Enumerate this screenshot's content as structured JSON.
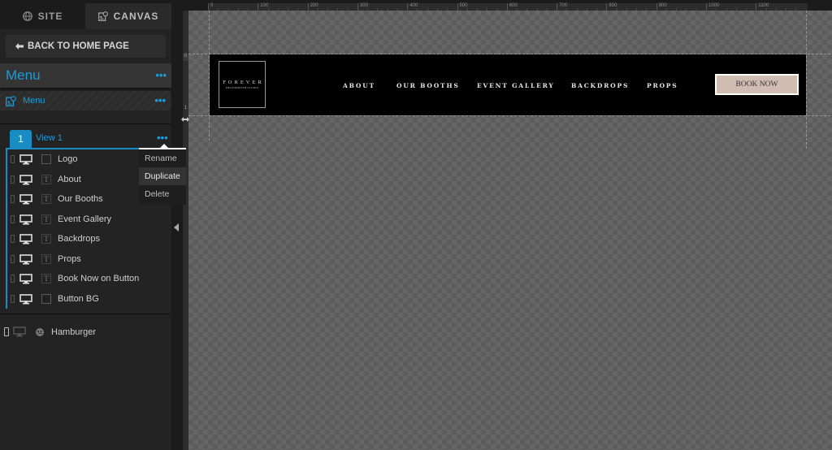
{
  "sidebar": {
    "tabs": [
      {
        "label": "SITE",
        "icon": "globe-icon",
        "active": false
      },
      {
        "label": "CANVAS",
        "icon": "canvas-icon",
        "active": true
      }
    ],
    "back_button": "BACK TO HOME PAGE",
    "section_title": "Menu",
    "sub_item": {
      "label": "Menu",
      "icon": "canvas-icon"
    },
    "view": {
      "number": "1",
      "label": "View 1"
    },
    "layers": [
      {
        "name": "Logo",
        "type": "box"
      },
      {
        "name": "About",
        "type": "text"
      },
      {
        "name": "Our Booths",
        "type": "text"
      },
      {
        "name": "Event Gallery",
        "type": "text"
      },
      {
        "name": "Backdrops",
        "type": "text"
      },
      {
        "name": "Props",
        "type": "text"
      },
      {
        "name": "Book Now on Button",
        "type": "text"
      },
      {
        "name": "Button BG",
        "type": "box"
      }
    ],
    "hamburger": {
      "name": "Hamburger"
    },
    "more_glyph": "•••",
    "text_type_glyph": "T"
  },
  "context_menu": {
    "items": [
      {
        "label": "Rename",
        "active": false
      },
      {
        "label": "Duplicate",
        "active": true
      },
      {
        "label": "Delete",
        "active": false
      }
    ]
  },
  "canvas": {
    "ruler_labels": [
      "0",
      "100",
      "200",
      "300",
      "400",
      "500",
      "600",
      "700",
      "800",
      "900",
      "1000",
      "1100"
    ],
    "left_ruler_zero": "0",
    "left_ruler_one": "1",
    "colors": {
      "accent": "#1a9bd7",
      "button_bg": "#d1bcb1",
      "header_bg": "#000000"
    }
  },
  "preview": {
    "logo": {
      "line1": "FOREVER",
      "line2": "PHOTOBOOTH STUDIO"
    },
    "nav": [
      "ABOUT",
      "OUR BOOTHS",
      "EVENT GALLERY",
      "BACKDROPS",
      "PROPS"
    ],
    "book_button": "BOOK NOW"
  }
}
